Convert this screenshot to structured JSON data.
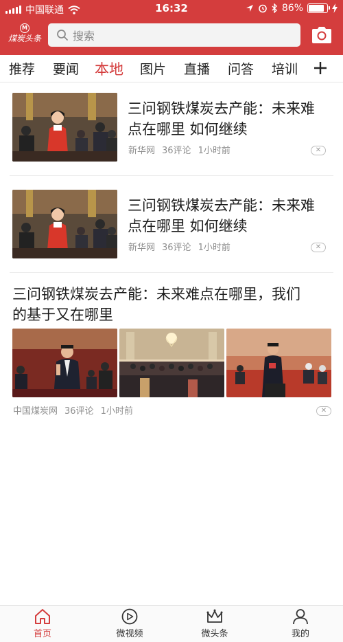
{
  "status_bar": {
    "carrier": "中国联通",
    "time": "16:32",
    "battery_percent": "86%",
    "battery_level": 0.86,
    "icons": [
      "signal-icon",
      "wifi-icon",
      "location-arrow-icon",
      "alarm-icon",
      "bluetooth-icon",
      "battery-icon",
      "charging-icon"
    ]
  },
  "header": {
    "logo_text": "煤炭头条",
    "search_placeholder": "搜索",
    "icons": [
      "search-icon",
      "camera-icon"
    ]
  },
  "colors": {
    "brand_red": "#d43d3d",
    "muted_text": "#8e8e8e"
  },
  "tabs": [
    {
      "label": "推荐"
    },
    {
      "label": "要闻"
    },
    {
      "label": "本地",
      "active": true
    },
    {
      "label": "图片"
    },
    {
      "label": "直播"
    },
    {
      "label": "问答"
    },
    {
      "label": "培训"
    }
  ],
  "news": [
    {
      "title_line1": "三问钢铁煤炭去产能：未来难",
      "title_line2": "点在哪里 如何继续",
      "source": "新华网",
      "comments": "36评论",
      "time": "1小时前"
    },
    {
      "title_line1": "三问钢铁煤炭去产能：未来难",
      "title_line2": "点在哪里 如何继续",
      "source": "新华网",
      "comments": "36评论",
      "time": "1小时前"
    },
    {
      "title_line1": "三问钢铁煤炭去产能：未来难点在哪里，我们",
      "title_line2": "的基于又在哪里",
      "source": "中国煤炭网",
      "comments": "36评论",
      "time": "1小时前"
    }
  ],
  "bottom_nav": [
    {
      "label": "首页",
      "icon": "home-icon",
      "active": true
    },
    {
      "label": "微视频",
      "icon": "play-circle-icon"
    },
    {
      "label": "微头条",
      "icon": "crown-icon"
    },
    {
      "label": "我的",
      "icon": "user-icon"
    }
  ]
}
